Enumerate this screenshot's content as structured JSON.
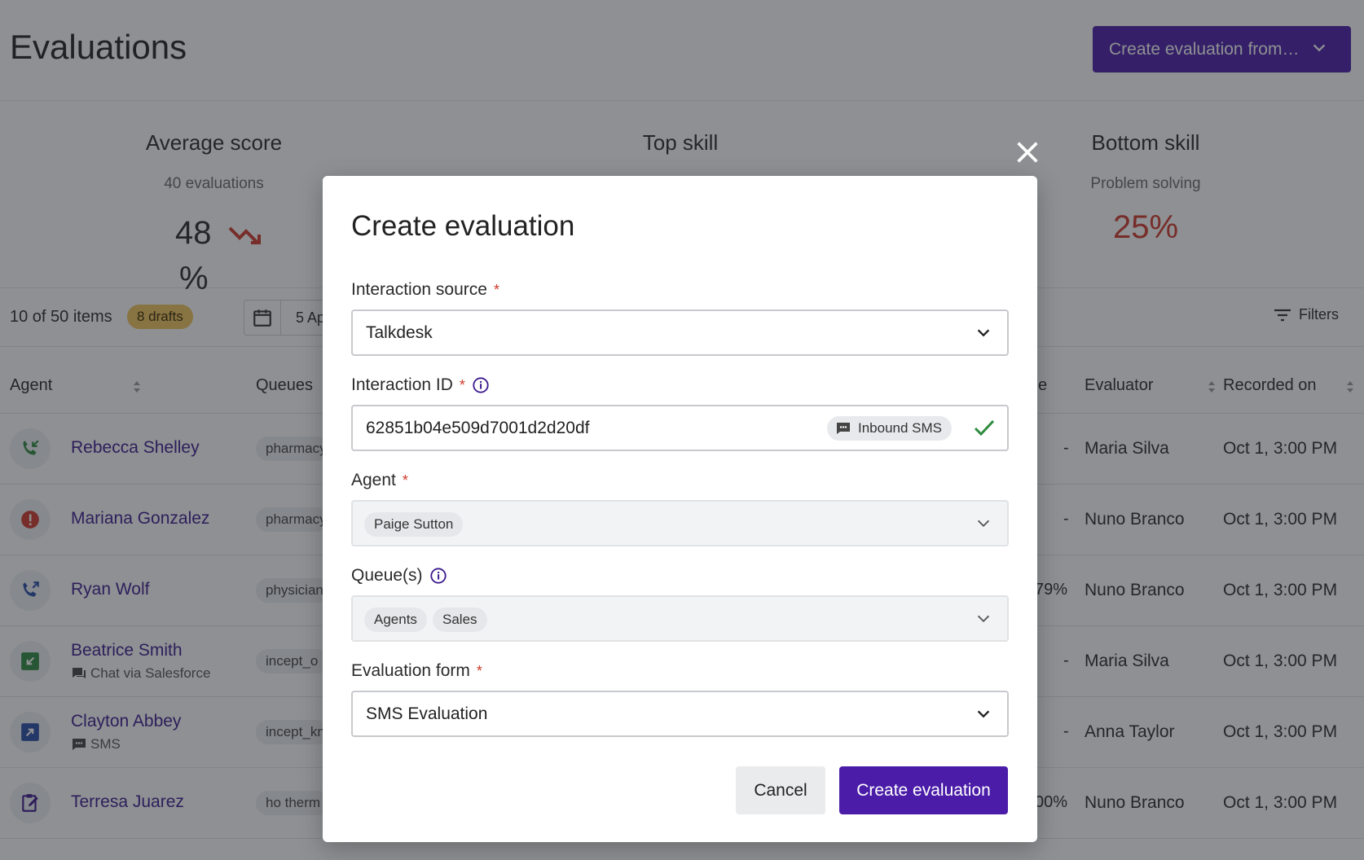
{
  "page": {
    "title": "Evaluations",
    "create_from_label": "Create evaluation from…"
  },
  "stats": {
    "average": {
      "title": "Average score",
      "sub": "40 evaluations",
      "value": "48",
      "unit": "%"
    },
    "top": {
      "title": "Top skill"
    },
    "bottom": {
      "title": "Bottom skill",
      "sub": "Problem solving",
      "value": "25%"
    }
  },
  "toolbar": {
    "items_count": "10 of 50 items",
    "drafts": "8 drafts",
    "date_text": "5 Ap",
    "filters": "Filters"
  },
  "table": {
    "headers": {
      "agent": "Agent",
      "queues": "Queues",
      "score_fragment": "e",
      "evaluator": "Evaluator",
      "recorded": "Recorded on"
    },
    "rows": [
      {
        "name": "Rebecca Shelley",
        "sub": "",
        "queue": "pharmacy",
        "score": "-",
        "evaluator": "Maria Silva",
        "recorded": "Oct 1, 3:00 PM",
        "icon": "inbound-call-icon"
      },
      {
        "name": "Mariana Gonzalez",
        "sub": "",
        "queue": "pharmacy",
        "score": "-",
        "evaluator": "Nuno Branco",
        "recorded": "Oct 1, 3:00 PM",
        "icon": "alert-icon"
      },
      {
        "name": "Ryan Wolf",
        "sub": "",
        "queue": "physician",
        "score": "79%",
        "evaluator": "Nuno Branco",
        "recorded": "Oct 1, 3:00 PM",
        "icon": "outbound-call-icon"
      },
      {
        "name": "Beatrice Smith",
        "sub": "Chat via Salesforce",
        "queue": "incept_o",
        "score": "-",
        "evaluator": "Maria Silva",
        "recorded": "Oct 1, 3:00 PM",
        "icon": "inbound-message-icon"
      },
      {
        "name": "Clayton Abbey",
        "sub": "SMS",
        "queue": "incept_kn",
        "score": "-",
        "evaluator": "Anna Taylor",
        "recorded": "Oct 1, 3:00 PM",
        "icon": "outbound-message-icon"
      },
      {
        "name": "Terresa Juarez",
        "sub": "",
        "queue": "ho therm",
        "score": "00%",
        "evaluator": "Nuno Branco",
        "recorded": "Oct 1, 3:00 PM",
        "icon": "edit-form-icon"
      }
    ]
  },
  "modal": {
    "title": "Create evaluation",
    "source": {
      "label": "Interaction source",
      "required": "*",
      "value": "Talkdesk"
    },
    "interaction_id": {
      "label": "Interaction ID",
      "required": "*",
      "value": "62851b04e509d7001d2d20df",
      "channel_chip": "Inbound SMS"
    },
    "agent": {
      "label": "Agent",
      "required": "*",
      "chip": "Paige Sutton"
    },
    "queues": {
      "label": "Queue(s)",
      "chips": [
        "Agents",
        "Sales"
      ]
    },
    "form": {
      "label": "Evaluation form",
      "required": "*",
      "value": "SMS Evaluation"
    },
    "cancel_label": "Cancel",
    "create_label": "Create evaluation"
  },
  "colors": {
    "accent": "#4a1ca8",
    "link": "#3d1a8e",
    "danger": "#d0392b",
    "success": "#2e8b3e",
    "draft_badge": "#f2c55c"
  }
}
